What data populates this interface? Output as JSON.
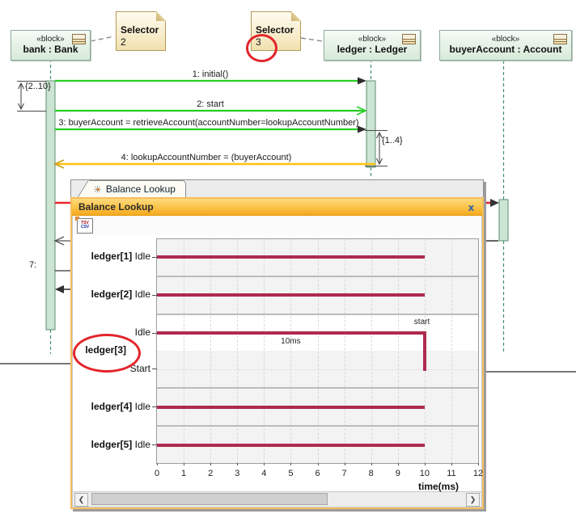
{
  "diagram": {
    "blocks": [
      {
        "stereotype": "«block»",
        "name": "bank : Bank"
      },
      {
        "stereotype": "«block»",
        "name": "ledger : Ledger"
      },
      {
        "stereotype": "«block»",
        "name": "buyerAccount : Account"
      }
    ],
    "notes": [
      {
        "title": "Selector",
        "value": "2"
      },
      {
        "title": "Selector",
        "value": "3"
      }
    ],
    "messages": [
      {
        "label": "1: initial()"
      },
      {
        "label": "2: start"
      },
      {
        "label": "3: buyerAccount = retrieveAccount(accountNumber=lookupAccountNumber)"
      },
      {
        "label": "4: lookupAccountNumber = (buyerAccount)"
      },
      {
        "label": "7:"
      }
    ],
    "constraints": [
      {
        "label": "{2..10}"
      },
      {
        "label": "{1..4}"
      }
    ]
  },
  "window": {
    "tab": {
      "label": "Balance Lookup",
      "icon": "timing-diagram-icon",
      "icon_glyph": "✳"
    },
    "title_bar": {
      "title": "Balance Lookup",
      "close_label": "x"
    },
    "toolbar": {
      "export_icon": "export-tsv-csv-icon",
      "tsv": "TSV",
      "csv": "CSV"
    },
    "scrollbar": {
      "left_arrow": "❮",
      "right_arrow": "❯"
    }
  },
  "colors": {
    "title_accent": "#F6A81F",
    "highlight_red": "#E3242B",
    "message_green": "#24CE24",
    "message_yellow": "#FFC20E",
    "timeline_red": "#AF2A4E",
    "lifeline_green": "#43906F"
  },
  "chart_data": {
    "type": "line",
    "subtype": "timing-diagram",
    "title": "Balance Lookup",
    "xlabel": "time(ms)",
    "xlim": [
      0,
      12
    ],
    "x_ticks": [
      0,
      1,
      2,
      3,
      4,
      5,
      6,
      7,
      8,
      9,
      10,
      11,
      12
    ],
    "grid": true,
    "line_color": "#AF2A4E",
    "lifelines": [
      {
        "name": "ledger[1]",
        "states": [
          "Idle"
        ],
        "segments": [
          {
            "state": "Idle",
            "from": 0,
            "to": 10
          }
        ]
      },
      {
        "name": "ledger[2]",
        "states": [
          "Idle"
        ],
        "segments": [
          {
            "state": "Idle",
            "from": 0,
            "to": 10
          }
        ]
      },
      {
        "name": "ledger[3]",
        "states": [
          "Idle",
          "Start"
        ],
        "circled": true,
        "segments": [
          {
            "state": "Idle",
            "from": 0,
            "to": 10
          },
          {
            "transition_to": "Start",
            "at": 10
          }
        ],
        "annotations": [
          {
            "text": "10ms",
            "t": 5,
            "anchor": "below"
          },
          {
            "text": "start",
            "t": 9.9,
            "anchor": "above"
          }
        ]
      },
      {
        "name": "ledger[4]",
        "states": [
          "Idle"
        ],
        "segments": [
          {
            "state": "Idle",
            "from": 0,
            "to": 10
          }
        ]
      },
      {
        "name": "ledger[5]",
        "states": [
          "Idle"
        ],
        "segments": [
          {
            "state": "Idle",
            "from": 0,
            "to": 10
          }
        ]
      }
    ]
  }
}
